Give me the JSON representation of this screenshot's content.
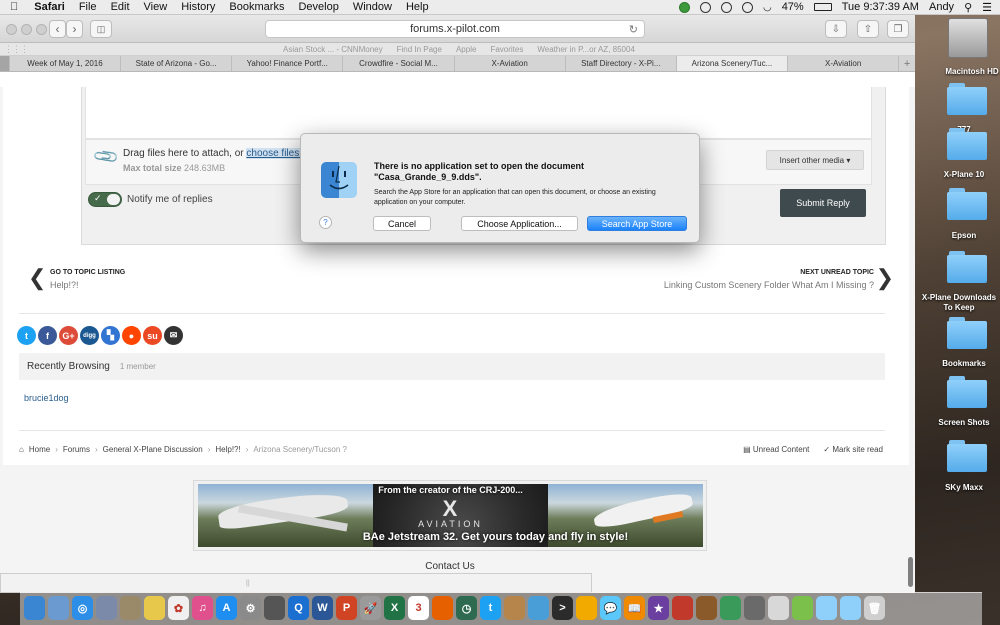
{
  "menubar": {
    "apple": "",
    "app": "Safari",
    "menus": [
      "File",
      "Edit",
      "View",
      "History",
      "Bookmarks",
      "Develop",
      "Window",
      "Help"
    ],
    "battery": "47%",
    "clock": "Tue 9:37:39 AM",
    "user": "Andy"
  },
  "browser": {
    "url": "forums.x-pilot.com",
    "favorites": [
      "Asian Stock ... - CNNMoney",
      "Find In Page",
      "Apple",
      "Favorites",
      "Weather in P...or AZ, 85004"
    ],
    "tabs": [
      "Week of May 1, 2016",
      "State of Arizona - Go...",
      "Yahoo! Finance Portf...",
      "Crowdfire - Social M...",
      "X-Aviation",
      "Staff Directory - X-Pi...",
      "Arizona Scenery/Tuc...",
      "X-Aviation"
    ],
    "new_tab": "+"
  },
  "reply": {
    "drag_text": "Drag files here to attach, or",
    "choose_files": "choose files...",
    "max_label": "Max total size",
    "max_value": "248.63MB",
    "insert_media": "Insert other media ▾",
    "notify": "Notify me of replies",
    "submit": "Submit Reply"
  },
  "topic_nav": {
    "prev_label": "GO TO TOPIC LISTING",
    "prev_title": "Help!?!",
    "next_label": "NEXT UNREAD TOPIC",
    "next_title": "Linking Custom Scenery Folder What Am I Missing ?"
  },
  "social": [
    {
      "icon": "twitter-icon",
      "glyph": "t",
      "color": "#1da1f2"
    },
    {
      "icon": "facebook-icon",
      "glyph": "f",
      "color": "#3b5998"
    },
    {
      "icon": "google-plus-icon",
      "glyph": "G+",
      "color": "#dd4b39"
    },
    {
      "icon": "digg-icon",
      "glyph": "digg",
      "color": "#1b5891"
    },
    {
      "icon": "delicious-icon",
      "glyph": "▚",
      "color": "#3274d1"
    },
    {
      "icon": "reddit-icon",
      "glyph": "●",
      "color": "#ff4500"
    },
    {
      "icon": "stumbleupon-icon",
      "glyph": "su",
      "color": "#eb4924"
    },
    {
      "icon": "email-icon",
      "glyph": "✉",
      "color": "#333333"
    }
  ],
  "recent": {
    "title": "Recently Browsing",
    "count": "1 member",
    "member": "brucie1dog"
  },
  "breadcrumb": {
    "home": "Home",
    "items": [
      "Forums",
      "General X-Plane Discussion",
      "Help!?!"
    ],
    "current": "Arizona Scenery/Tucson ?",
    "sep": "›"
  },
  "page_links": {
    "unread": "Unread Content",
    "mark_read": "Mark site read"
  },
  "banner": {
    "top": "From the creator of the CRJ-200...",
    "logo_x": "X",
    "logo_name": "AVIATION",
    "bottom": "BAe Jetstream 32. Get yours today and fly in style!"
  },
  "footer": {
    "contact": "Contact Us"
  },
  "dialog": {
    "title": "There is no application set to open the document \"Casa_Grande_9_9.dds\".",
    "message": "Search the App Store for an application that can open this document, or choose an existing application on your computer.",
    "help": "?",
    "cancel": "Cancel",
    "choose": "Choose Application...",
    "search": "Search App Store"
  },
  "desktop": {
    "hdd": "Macintosh HD",
    "folders": [
      "777",
      "X-Plane 10",
      "Epson",
      "X-Plane Downloads To Keep",
      "Bookmarks",
      "Screen Shots",
      "SKy Maxx"
    ]
  },
  "dock": [
    {
      "name": "finder",
      "color": "#3a86d3",
      "glyph": ""
    },
    {
      "name": "preview",
      "color": "#6a9ad0",
      "glyph": ""
    },
    {
      "name": "safari",
      "color": "#2c8ee6",
      "glyph": "◎"
    },
    {
      "name": "app-store-old",
      "color": "#7b8aa8",
      "glyph": ""
    },
    {
      "name": "contacts",
      "color": "#9a8a6a",
      "glyph": ""
    },
    {
      "name": "notes",
      "color": "#e8c84a",
      "glyph": ""
    },
    {
      "name": "photos",
      "color": "#f0f0f0",
      "glyph": "✿"
    },
    {
      "name": "itunes",
      "color": "#e0508c",
      "glyph": "♫"
    },
    {
      "name": "app-store",
      "color": "#1f8ef1",
      "glyph": "A"
    },
    {
      "name": "system-prefs",
      "color": "#8a8a8a",
      "glyph": "⚙"
    },
    {
      "name": "steam",
      "color": "#555555",
      "glyph": ""
    },
    {
      "name": "quicktime",
      "color": "#1b6fd0",
      "glyph": "Q"
    },
    {
      "name": "word",
      "color": "#2b5797",
      "glyph": "W"
    },
    {
      "name": "powerpoint",
      "color": "#d04423",
      "glyph": "P"
    },
    {
      "name": "launchpad",
      "color": "#9a9a9a",
      "glyph": "🚀"
    },
    {
      "name": "excel",
      "color": "#217346",
      "glyph": "X"
    },
    {
      "name": "calendar",
      "color": "#ffffff",
      "glyph": "3"
    },
    {
      "name": "firefox",
      "color": "#e66000",
      "glyph": ""
    },
    {
      "name": "time-machine",
      "color": "#2d6a4f",
      "glyph": "◷"
    },
    {
      "name": "twitter",
      "color": "#1da1f2",
      "glyph": "t"
    },
    {
      "name": "ibooks-old",
      "color": "#b5854b",
      "glyph": ""
    },
    {
      "name": "activity",
      "color": "#4a9ed8",
      "glyph": ""
    },
    {
      "name": "terminal",
      "color": "#2b2b2b",
      "glyph": ">"
    },
    {
      "name": "bird-app",
      "color": "#f2a900",
      "glyph": ""
    },
    {
      "name": "messages",
      "color": "#5ac8fa",
      "glyph": "💬"
    },
    {
      "name": "ibooks",
      "color": "#f08a00",
      "glyph": "📖"
    },
    {
      "name": "imovie",
      "color": "#6b3fa0",
      "glyph": "★"
    },
    {
      "name": "photo-booth",
      "color": "#c0392b",
      "glyph": ""
    },
    {
      "name": "guitar",
      "color": "#8b5a2b",
      "glyph": ""
    },
    {
      "name": "globe",
      "color": "#3a9a5a",
      "glyph": ""
    },
    {
      "name": "x-plane",
      "color": "#6a6a6a",
      "glyph": ""
    },
    {
      "name": "preview-img",
      "color": "#d8d8d8",
      "glyph": ""
    },
    {
      "name": "downloads-ball",
      "color": "#7ac04a",
      "glyph": ""
    },
    {
      "name": "folder-1",
      "color": "#8fd0fb",
      "glyph": ""
    },
    {
      "name": "folder-2",
      "color": "#8fd0fb",
      "glyph": ""
    },
    {
      "name": "trash",
      "color": "#cfcfcf",
      "glyph": "🗑"
    }
  ]
}
